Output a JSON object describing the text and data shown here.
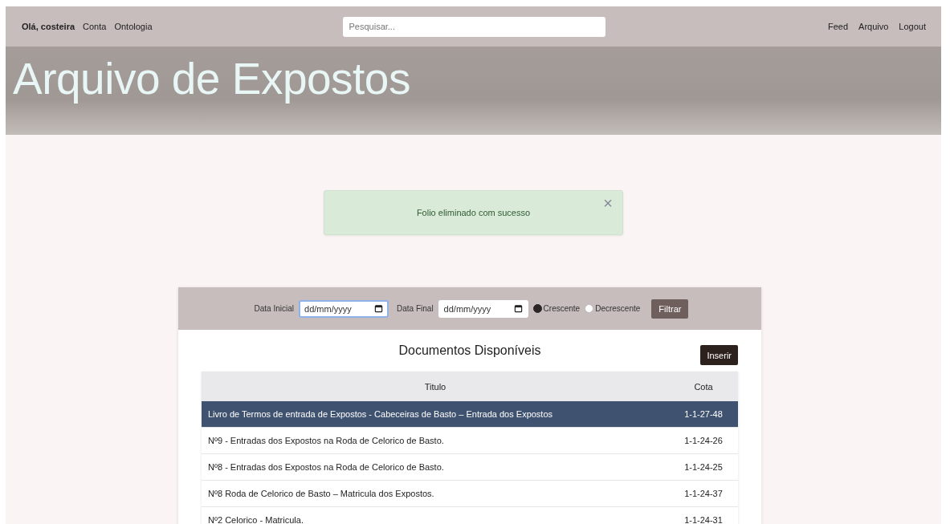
{
  "nav": {
    "greeting": "Olá, costeira",
    "left_links": [
      "Conta",
      "Ontologia"
    ],
    "search": {
      "placeholder": "Pesquisar..."
    },
    "right_links": [
      "Feed",
      "Arquivo",
      "Logout"
    ]
  },
  "hero": {
    "title": "Arquivo de Expostos"
  },
  "alert": {
    "message": "Folio eliminado com sucesso",
    "close": "×"
  },
  "filter": {
    "start_label": "Data Inicial",
    "start_value": "dd/mm/yyyy",
    "start_focused": true,
    "end_label": "Data Final",
    "end_value": "dd/mm/yyyy",
    "end_focused": false,
    "order": [
      {
        "label": "Crescente",
        "selected": true
      },
      {
        "label": "Decrescente",
        "selected": false
      }
    ],
    "button": "Filtrar"
  },
  "documents": {
    "title": "Documentos Disponíveis",
    "insert_button": "Inserir",
    "columns": [
      "Titulo",
      "Cota"
    ],
    "rows": [
      {
        "title": "Livro de Termos de entrada de Expostos - Cabeceiras de Basto – Entrada dos Expostos",
        "cota": "1-1-27-48",
        "selected": true
      },
      {
        "title": "Nº9 - Entradas dos Expostos na Roda de Celorico de Basto.",
        "cota": "1-1-24-26",
        "selected": false
      },
      {
        "title": "Nº8 - Entradas dos Expostos na Roda de Celorico de Basto.",
        "cota": "1-1-24-25",
        "selected": false
      },
      {
        "title": "Nº8 Roda de Celorico de Basto – Matricula dos Expostos.",
        "cota": "1-1-24-37",
        "selected": false
      },
      {
        "title": "Nº2 Celorico - Matricula.",
        "cota": "1-1-24-31",
        "selected": false
      }
    ]
  }
}
